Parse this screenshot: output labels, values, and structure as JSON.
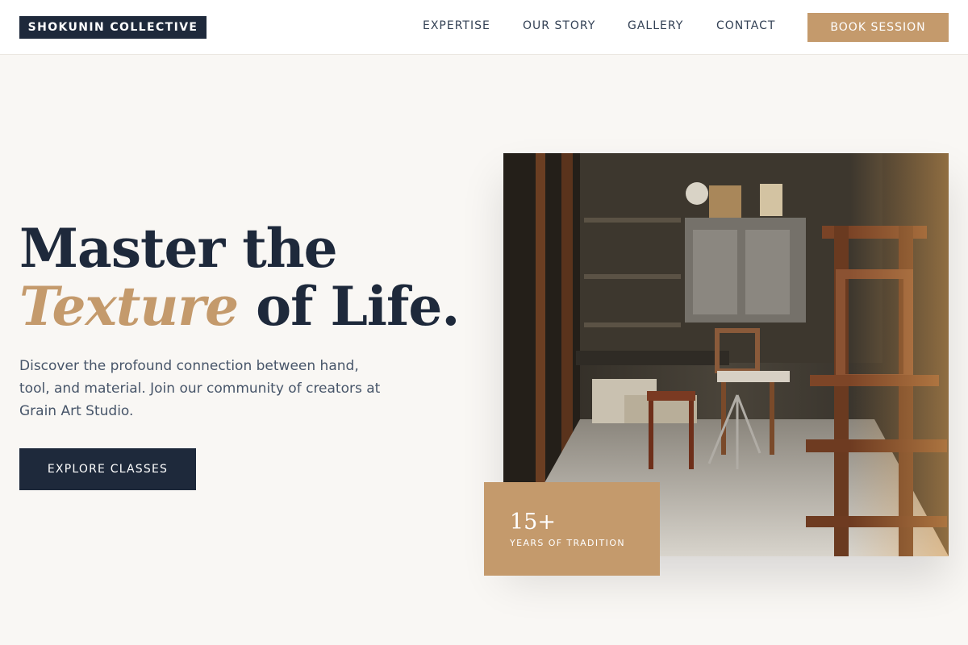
{
  "header": {
    "logo": "SHOKUNIN COLLECTIVE",
    "nav": [
      "EXPERTISE",
      "OUR STORY",
      "GALLERY",
      "CONTACT"
    ],
    "cta": "BOOK SESSION"
  },
  "hero": {
    "headline_line1": "Master the",
    "headline_accent": "Texture",
    "headline_line2_rest": " of Life.",
    "description": "Discover the profound connection between hand, tool, and material. Join our community of creators at Grain Art Studio.",
    "button": "EXPLORE CLASSES"
  },
  "stat": {
    "number": "15+",
    "label": "YEARS OF TRADITION"
  },
  "colors": {
    "navy": "#1e293b",
    "accent": "#c49a6c",
    "background": "#f9f7f4"
  }
}
